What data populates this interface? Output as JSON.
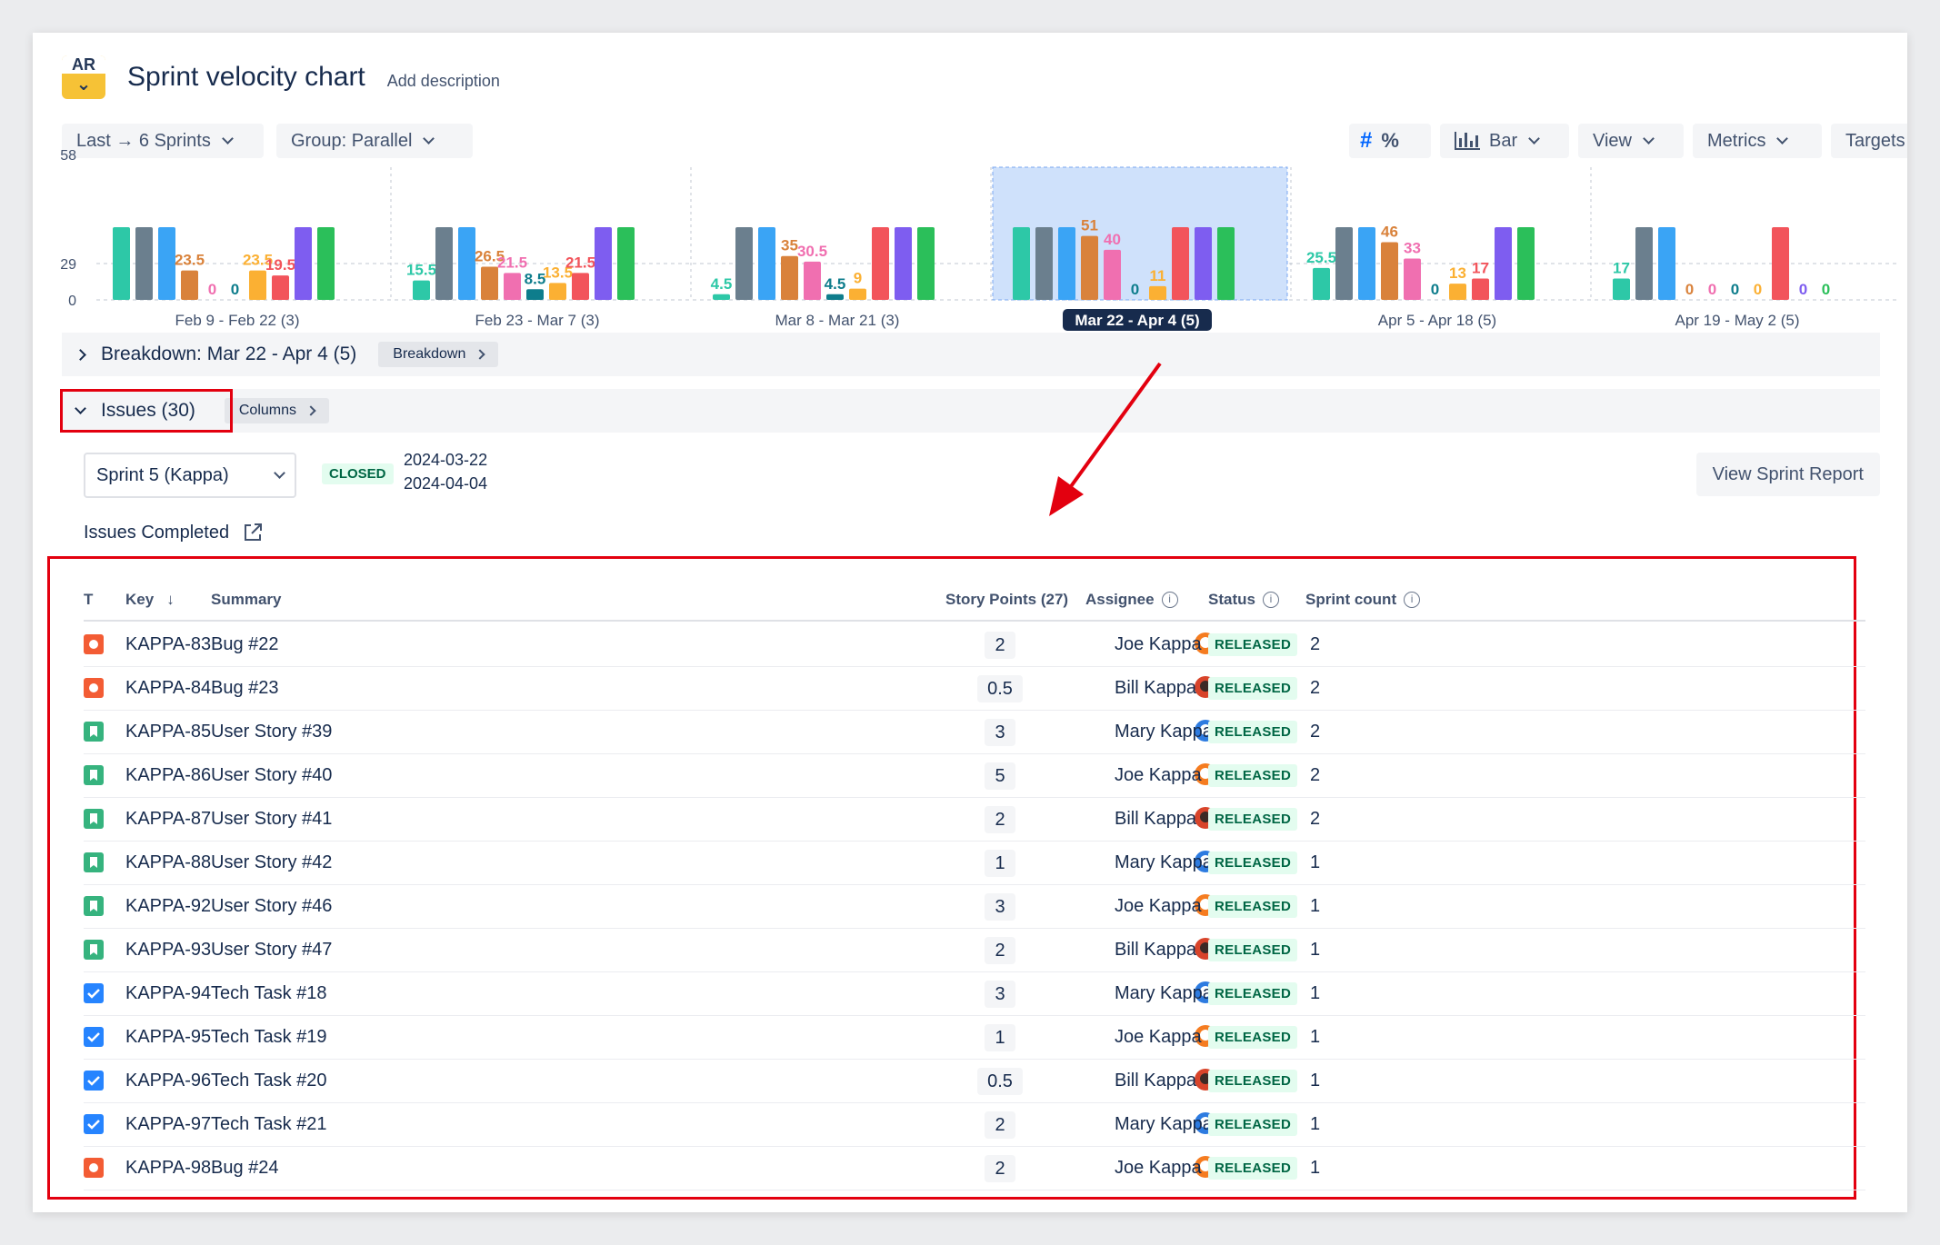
{
  "header": {
    "title": "Sprint velocity chart",
    "add_description": "Add description",
    "logo_text": "AR"
  },
  "toolbar": {
    "range_label": "Last → 6 Sprints",
    "group_label": "Group: Parallel",
    "hash_symbol": "#",
    "percent_symbol": "%",
    "chart_type_label": "Bar",
    "view_label": "View",
    "metrics_label": "Metrics",
    "targets_label": "Targets"
  },
  "chart_data": {
    "type": "bar",
    "y_ticks": [
      "0",
      "29"
    ],
    "y_top_partial": "58",
    "selected_index": 3,
    "categories": [
      "Feb 9 - Feb 22 (3)",
      "Feb 23 - Mar 7 (3)",
      "Mar 8 - Mar 21 (3)",
      "Mar 22 - Apr 4 (5)",
      "Apr 5 - Apr 18 (5)",
      "Apr 19 - May 2 (5)"
    ],
    "series_colors": [
      "#2dc8a7",
      "#6b7f8e",
      "#3aa4f5",
      "#d9823b",
      "#f06fb0",
      "#0e7d8c",
      "#fbb033",
      "#f2545b",
      "#7e5df0",
      "#2bbf5a"
    ],
    "groups": [
      {
        "values": [
          58,
          58,
          58,
          23.5,
          0,
          0,
          23.5,
          19.5,
          58,
          58
        ],
        "labels": [
          "",
          "",
          "",
          "23.5",
          "0",
          "0",
          "23.5",
          "19.5",
          "",
          ""
        ]
      },
      {
        "values": [
          15.5,
          58,
          58,
          26.5,
          21.5,
          8.5,
          13.5,
          21.5,
          58,
          58
        ],
        "labels": [
          "15.5",
          "",
          "",
          "26.5",
          "21.5",
          "8.5",
          "13.5",
          "21.5",
          "",
          ""
        ]
      },
      {
        "values": [
          4.5,
          58,
          58,
          35,
          30.5,
          4.5,
          9,
          58,
          58,
          58
        ],
        "labels": [
          "4.5",
          "",
          "",
          "35",
          "30.5",
          "4.5",
          "9",
          "",
          "",
          ""
        ]
      },
      {
        "values": [
          58,
          58,
          58,
          51,
          40,
          0,
          11,
          58,
          58,
          58
        ],
        "labels": [
          "",
          "",
          "",
          "51",
          "40",
          "0",
          "11",
          "",
          "",
          ""
        ]
      },
      {
        "values": [
          25.5,
          58,
          58,
          46,
          33,
          0,
          13,
          17,
          58,
          58
        ],
        "labels": [
          "25.5",
          "",
          "",
          "46",
          "33",
          "0",
          "13",
          "17",
          "",
          ""
        ]
      },
      {
        "values": [
          17,
          58,
          58,
          0,
          0,
          0,
          0,
          58,
          0,
          0
        ],
        "labels": [
          "17",
          "",
          "",
          "0",
          "0",
          "0",
          "0",
          "",
          "0",
          "0"
        ]
      }
    ]
  },
  "breakdown": {
    "label": "Breakdown: Mar 22 - Apr 4 (5)",
    "button": "Breakdown"
  },
  "issues": {
    "label": "Issues (30)",
    "button": "Columns"
  },
  "sprint": {
    "selected": "Sprint 5 (Kappa)",
    "state": "CLOSED",
    "start": "2024-03-22",
    "end": "2024-04-04",
    "view_report": "View Sprint Report"
  },
  "completed_label": "Issues Completed",
  "table": {
    "headers": {
      "type": "T",
      "key": "Key",
      "summary": "Summary",
      "points": "Story Points (27)",
      "assignee": "Assignee",
      "status": "Status",
      "sprint_count": "Sprint count"
    },
    "rows": [
      {
        "type": "bug",
        "key": "KAPPA-83",
        "summary": "Bug #22",
        "points": "2",
        "assignee": "Joe Kappa",
        "status": "RELEASED",
        "count": "2"
      },
      {
        "type": "bug",
        "key": "KAPPA-84",
        "summary": "Bug #23",
        "points": "0.5",
        "assignee": "Bill Kappa",
        "status": "RELEASED",
        "count": "2"
      },
      {
        "type": "story",
        "key": "KAPPA-85",
        "summary": "User Story #39",
        "points": "3",
        "assignee": "Mary Kappa",
        "status": "RELEASED",
        "count": "2"
      },
      {
        "type": "story",
        "key": "KAPPA-86",
        "summary": "User Story #40",
        "points": "5",
        "assignee": "Joe Kappa",
        "status": "RELEASED",
        "count": "2"
      },
      {
        "type": "story",
        "key": "KAPPA-87",
        "summary": "User Story #41",
        "points": "2",
        "assignee": "Bill Kappa",
        "status": "RELEASED",
        "count": "2"
      },
      {
        "type": "story",
        "key": "KAPPA-88",
        "summary": "User Story #42",
        "points": "1",
        "assignee": "Mary Kappa",
        "status": "RELEASED",
        "count": "1"
      },
      {
        "type": "story",
        "key": "KAPPA-92",
        "summary": "User Story #46",
        "points": "3",
        "assignee": "Joe Kappa",
        "status": "RELEASED",
        "count": "1"
      },
      {
        "type": "story",
        "key": "KAPPA-93",
        "summary": "User Story #47",
        "points": "2",
        "assignee": "Bill Kappa",
        "status": "RELEASED",
        "count": "1"
      },
      {
        "type": "task",
        "key": "KAPPA-94",
        "summary": "Tech Task #18",
        "points": "3",
        "assignee": "Mary Kappa",
        "status": "RELEASED",
        "count": "1"
      },
      {
        "type": "task",
        "key": "KAPPA-95",
        "summary": "Tech Task #19",
        "points": "1",
        "assignee": "Joe Kappa",
        "status": "RELEASED",
        "count": "1"
      },
      {
        "type": "task",
        "key": "KAPPA-96",
        "summary": "Tech Task #20",
        "points": "0.5",
        "assignee": "Bill Kappa",
        "status": "RELEASED",
        "count": "1"
      },
      {
        "type": "task",
        "key": "KAPPA-97",
        "summary": "Tech Task #21",
        "points": "2",
        "assignee": "Mary Kappa",
        "status": "RELEASED",
        "count": "1"
      },
      {
        "type": "bug",
        "key": "KAPPA-98",
        "summary": "Bug #24",
        "points": "2",
        "assignee": "Joe Kappa",
        "status": "RELEASED",
        "count": "1"
      }
    ]
  },
  "colors": {
    "bug": "#f35c34",
    "story": "#36b37e",
    "task": "#2684ff",
    "joe": "#f57c20",
    "bill": "#d8442a",
    "mary": "#2d7be0",
    "annotation": "#e3000f"
  }
}
